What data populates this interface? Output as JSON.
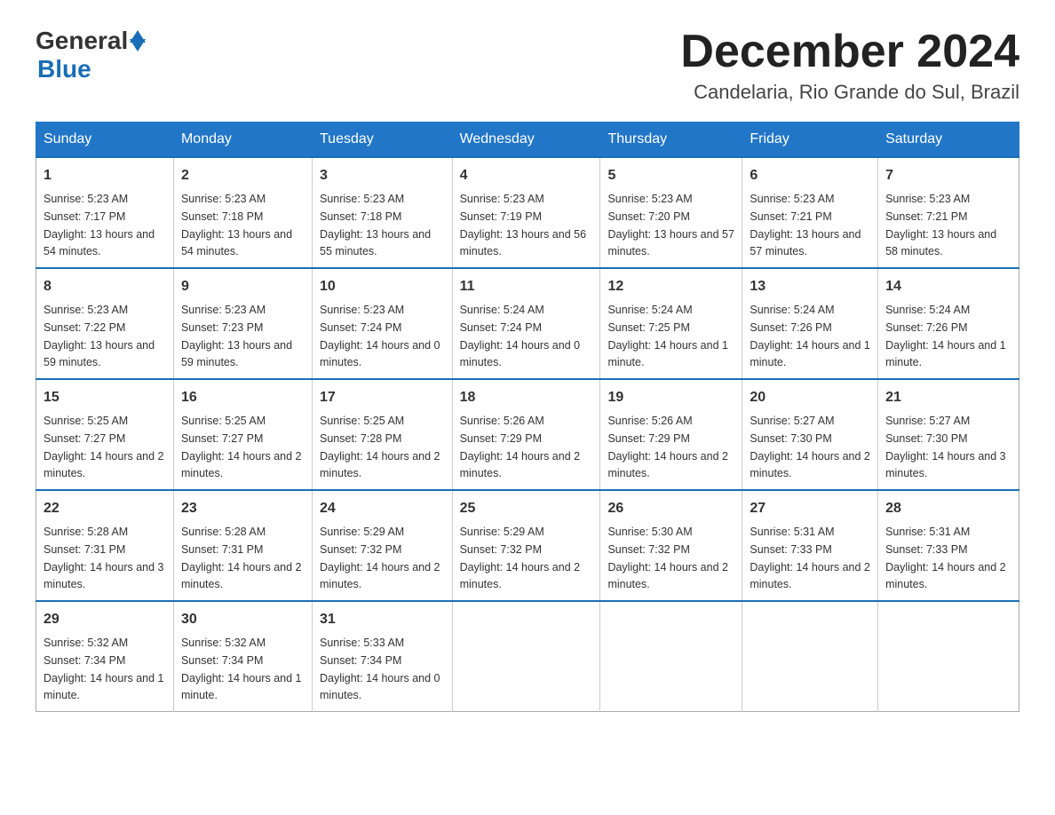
{
  "header": {
    "title": "December 2024",
    "subtitle": "Candelaria, Rio Grande do Sul, Brazil"
  },
  "logo": {
    "general": "General",
    "blue": "Blue"
  },
  "days_of_week": [
    "Sunday",
    "Monday",
    "Tuesday",
    "Wednesday",
    "Thursday",
    "Friday",
    "Saturday"
  ],
  "weeks": [
    [
      {
        "day": "1",
        "sunrise": "5:23 AM",
        "sunset": "7:17 PM",
        "daylight": "13 hours and 54 minutes."
      },
      {
        "day": "2",
        "sunrise": "5:23 AM",
        "sunset": "7:18 PM",
        "daylight": "13 hours and 54 minutes."
      },
      {
        "day": "3",
        "sunrise": "5:23 AM",
        "sunset": "7:18 PM",
        "daylight": "13 hours and 55 minutes."
      },
      {
        "day": "4",
        "sunrise": "5:23 AM",
        "sunset": "7:19 PM",
        "daylight": "13 hours and 56 minutes."
      },
      {
        "day": "5",
        "sunrise": "5:23 AM",
        "sunset": "7:20 PM",
        "daylight": "13 hours and 57 minutes."
      },
      {
        "day": "6",
        "sunrise": "5:23 AM",
        "sunset": "7:21 PM",
        "daylight": "13 hours and 57 minutes."
      },
      {
        "day": "7",
        "sunrise": "5:23 AM",
        "sunset": "7:21 PM",
        "daylight": "13 hours and 58 minutes."
      }
    ],
    [
      {
        "day": "8",
        "sunrise": "5:23 AM",
        "sunset": "7:22 PM",
        "daylight": "13 hours and 59 minutes."
      },
      {
        "day": "9",
        "sunrise": "5:23 AM",
        "sunset": "7:23 PM",
        "daylight": "13 hours and 59 minutes."
      },
      {
        "day": "10",
        "sunrise": "5:23 AM",
        "sunset": "7:24 PM",
        "daylight": "14 hours and 0 minutes."
      },
      {
        "day": "11",
        "sunrise": "5:24 AM",
        "sunset": "7:24 PM",
        "daylight": "14 hours and 0 minutes."
      },
      {
        "day": "12",
        "sunrise": "5:24 AM",
        "sunset": "7:25 PM",
        "daylight": "14 hours and 1 minute."
      },
      {
        "day": "13",
        "sunrise": "5:24 AM",
        "sunset": "7:26 PM",
        "daylight": "14 hours and 1 minute."
      },
      {
        "day": "14",
        "sunrise": "5:24 AM",
        "sunset": "7:26 PM",
        "daylight": "14 hours and 1 minute."
      }
    ],
    [
      {
        "day": "15",
        "sunrise": "5:25 AM",
        "sunset": "7:27 PM",
        "daylight": "14 hours and 2 minutes."
      },
      {
        "day": "16",
        "sunrise": "5:25 AM",
        "sunset": "7:27 PM",
        "daylight": "14 hours and 2 minutes."
      },
      {
        "day": "17",
        "sunrise": "5:25 AM",
        "sunset": "7:28 PM",
        "daylight": "14 hours and 2 minutes."
      },
      {
        "day": "18",
        "sunrise": "5:26 AM",
        "sunset": "7:29 PM",
        "daylight": "14 hours and 2 minutes."
      },
      {
        "day": "19",
        "sunrise": "5:26 AM",
        "sunset": "7:29 PM",
        "daylight": "14 hours and 2 minutes."
      },
      {
        "day": "20",
        "sunrise": "5:27 AM",
        "sunset": "7:30 PM",
        "daylight": "14 hours and 2 minutes."
      },
      {
        "day": "21",
        "sunrise": "5:27 AM",
        "sunset": "7:30 PM",
        "daylight": "14 hours and 3 minutes."
      }
    ],
    [
      {
        "day": "22",
        "sunrise": "5:28 AM",
        "sunset": "7:31 PM",
        "daylight": "14 hours and 3 minutes."
      },
      {
        "day": "23",
        "sunrise": "5:28 AM",
        "sunset": "7:31 PM",
        "daylight": "14 hours and 2 minutes."
      },
      {
        "day": "24",
        "sunrise": "5:29 AM",
        "sunset": "7:32 PM",
        "daylight": "14 hours and 2 minutes."
      },
      {
        "day": "25",
        "sunrise": "5:29 AM",
        "sunset": "7:32 PM",
        "daylight": "14 hours and 2 minutes."
      },
      {
        "day": "26",
        "sunrise": "5:30 AM",
        "sunset": "7:32 PM",
        "daylight": "14 hours and 2 minutes."
      },
      {
        "day": "27",
        "sunrise": "5:31 AM",
        "sunset": "7:33 PM",
        "daylight": "14 hours and 2 minutes."
      },
      {
        "day": "28",
        "sunrise": "5:31 AM",
        "sunset": "7:33 PM",
        "daylight": "14 hours and 2 minutes."
      }
    ],
    [
      {
        "day": "29",
        "sunrise": "5:32 AM",
        "sunset": "7:34 PM",
        "daylight": "14 hours and 1 minute."
      },
      {
        "day": "30",
        "sunrise": "5:32 AM",
        "sunset": "7:34 PM",
        "daylight": "14 hours and 1 minute."
      },
      {
        "day": "31",
        "sunrise": "5:33 AM",
        "sunset": "7:34 PM",
        "daylight": "14 hours and 0 minutes."
      },
      {
        "day": "",
        "sunrise": "",
        "sunset": "",
        "daylight": ""
      },
      {
        "day": "",
        "sunrise": "",
        "sunset": "",
        "daylight": ""
      },
      {
        "day": "",
        "sunrise": "",
        "sunset": "",
        "daylight": ""
      },
      {
        "day": "",
        "sunrise": "",
        "sunset": "",
        "daylight": ""
      }
    ]
  ],
  "labels": {
    "sunrise_prefix": "Sunrise: ",
    "sunset_prefix": "Sunset: ",
    "daylight_prefix": "Daylight: "
  }
}
